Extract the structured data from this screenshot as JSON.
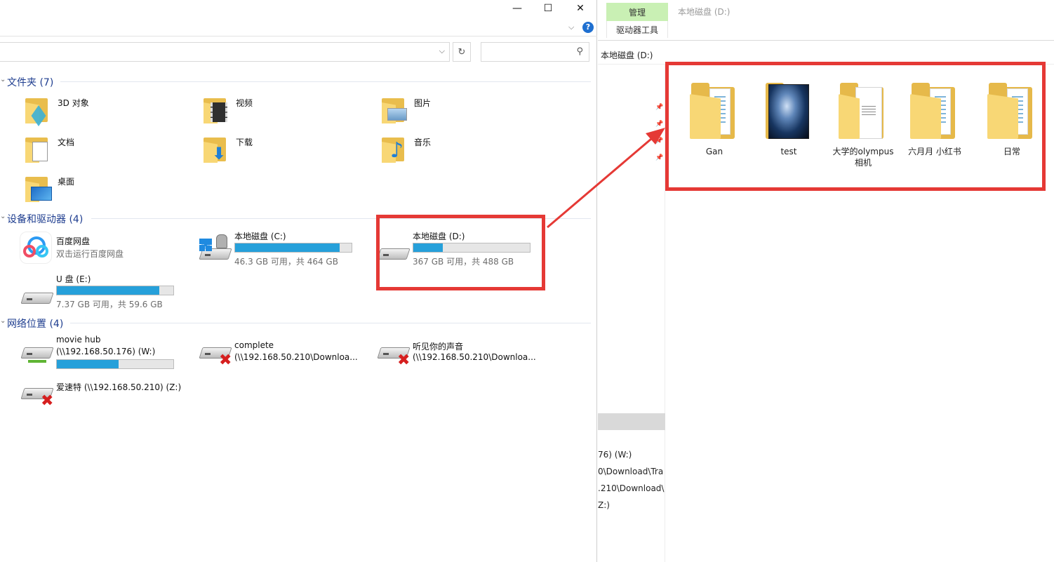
{
  "right_window": {
    "ribbon": {
      "manage_tab": "管理",
      "drive_tools_tab": "驱动器工具",
      "title": "本地磁盘 (D:)"
    },
    "address": "本地磁盘 (D:)",
    "nav_truncated": [
      "76) (W:)",
      "0\\Download\\Tra",
      ".210\\Download\\",
      "Z:)"
    ],
    "folders": [
      {
        "label": "Gan",
        "icon": "folder-icon"
      },
      {
        "label": "test",
        "icon": "image-folder-icon"
      },
      {
        "label": "大学的olympus 相机",
        "icon": "document-folder-icon"
      },
      {
        "label": "六月月 小红书",
        "icon": "folder-icon"
      },
      {
        "label": "日常",
        "icon": "folder-icon"
      }
    ]
  },
  "left_window": {
    "window_controls": {
      "minimize": "—",
      "maximize": "☐",
      "close": "✕"
    },
    "groups": {
      "folders": "文件夹 (7)",
      "devices": "设备和驱动器 (4)",
      "network": "网络位置 (4)"
    },
    "folder_items": [
      "3D 对象",
      "视频",
      "图片",
      "文档",
      "下载",
      "音乐",
      "桌面"
    ],
    "devices": {
      "baidu": {
        "name": "百度网盘",
        "sub": "双击运行百度网盘"
      },
      "c": {
        "name": "本地磁盘 (C:)",
        "sub": "46.3 GB 可用，共 464 GB",
        "used_fraction": 0.9
      },
      "d": {
        "name": "本地磁盘 (D:)",
        "sub": "367 GB 可用，共 488 GB",
        "used_fraction": 0.25
      },
      "e": {
        "name": "U 盘 (E:)",
        "sub": "7.37 GB 可用，共 59.6 GB",
        "used_fraction": 0.88
      }
    },
    "network": {
      "moviehub": {
        "name": "movie hub",
        "path": "(\\\\192.168.50.176) (W:)",
        "used_fraction": 0.53
      },
      "complete": {
        "name": "complete",
        "path": "(\\\\192.168.50.210\\Downloa..."
      },
      "voice": {
        "name": "听见你的声音",
        "path": "(\\\\192.168.50.210\\Downloa..."
      },
      "aisuite": {
        "name": "爱速特 (\\\\192.168.50.210) (Z:)"
      }
    }
  },
  "colors": {
    "accent_blue": "#26a0da",
    "highlight_red": "#e53935",
    "manage_green": "#c9f0b4",
    "group_title": "#1e3d8f"
  }
}
